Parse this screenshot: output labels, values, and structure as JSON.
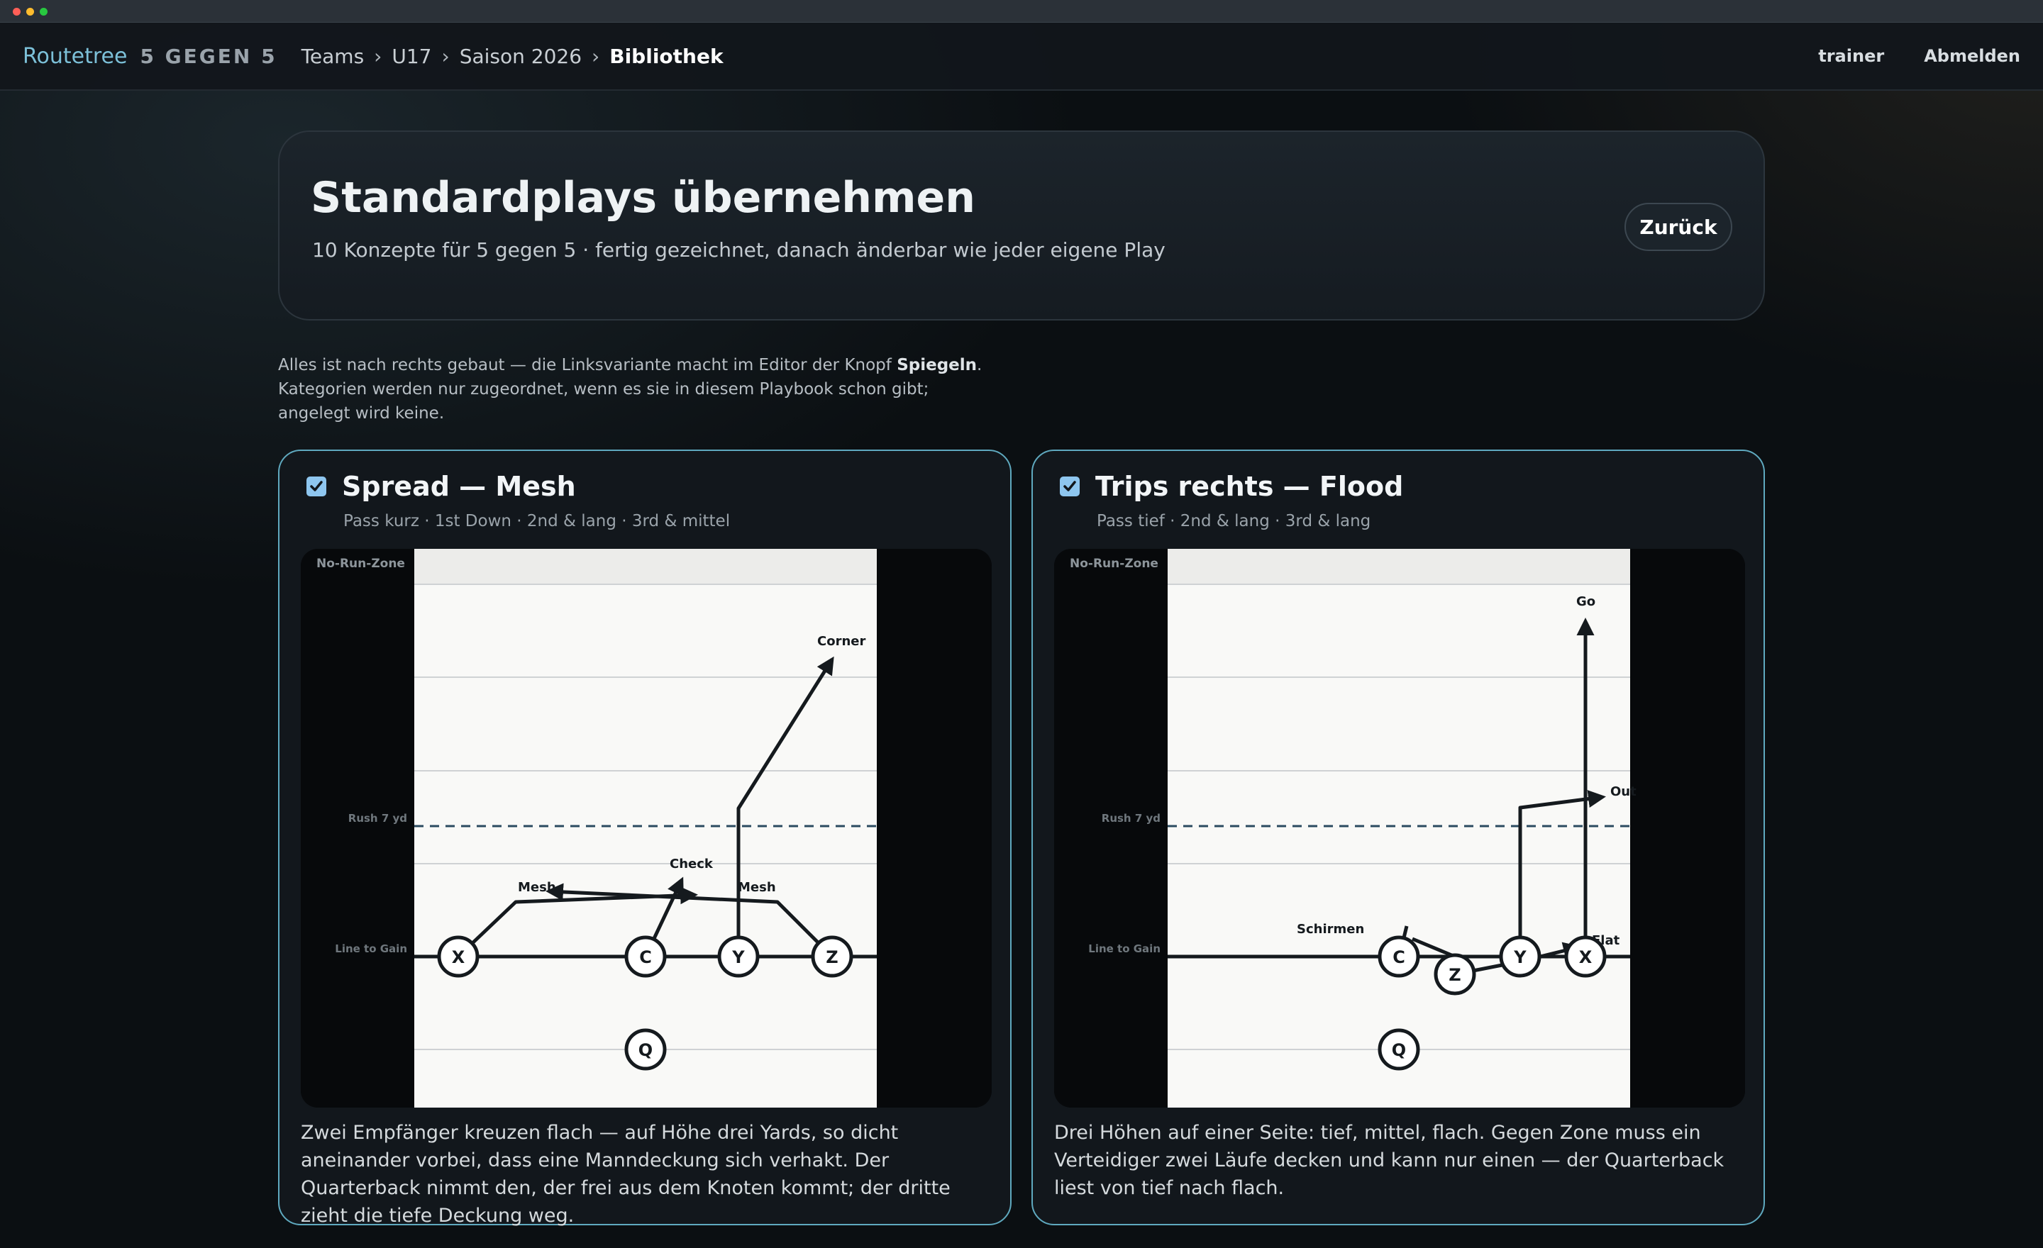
{
  "topbar": {
    "brand": "Routetree",
    "subtitle": "5 GEGEN 5",
    "breadcrumb": [
      "Teams",
      "U17",
      "Saison 2026",
      "Bibliothek"
    ],
    "user": "trainer",
    "logout": "Abmelden"
  },
  "hero": {
    "title": "Standardplays übernehmen",
    "subtitle": "10 Konzepte für 5 gegen 5 · fertig gezeichnet, danach änderbar wie jeder eigene Play",
    "back_label": "Zurück"
  },
  "note": {
    "line1_pre": "Alles ist nach rechts gebaut — die Linksvariante macht im Editor der Knopf ",
    "line1_bold": "Spiegeln",
    "line1_post": ".",
    "line2": "Kategorien werden nur zugeordnet, wenn es sie in diesem Playbook schon gibt;",
    "line3": "angelegt wird keine."
  },
  "field_labels": {
    "no_run": "No-Run-Zone",
    "rush": "Rush 7 yd",
    "ltg": "Line to Gain"
  },
  "plays": [
    {
      "checked": true,
      "title": "Spread — Mesh",
      "tags": "Pass kurz · 1st Down · 2nd & lang · 3rd & mittel",
      "description": "Zwei Empfänger kreuzen flach — auf Höhe drei Yards, so dicht aneinander vorbei, dass eine Manndeckung sich verhakt. Der Quarterback nimmt den, der frei aus dem Knoten kommt; der dritte zieht die tiefe Deckung weg.",
      "players": [
        "X",
        "C",
        "Y",
        "Z",
        "Q"
      ],
      "routes": [
        "Corner",
        "Check",
        "Mesh",
        "Mesh"
      ]
    },
    {
      "checked": true,
      "title": "Trips rechts — Flood",
      "tags": "Pass tief · 2nd & lang · 3rd & lang",
      "description": "Drei Höhen auf einer Seite: tief, mittel, flach. Gegen Zone muss ein Verteidiger zwei Läufe decken und kann nur einen — der Quarterback liest von tief nach flach.",
      "players": [
        "C",
        "Z",
        "Y",
        "X",
        "Q"
      ],
      "routes": [
        "Go",
        "Out",
        "Flat",
        "Schirmen"
      ]
    }
  ],
  "colors": {
    "accent": "#7cc0d8",
    "card_border": "#5fa9bf",
    "checkbox": "#8ec6ef",
    "field": "#f9f9f7",
    "rush_line": "#2b4a60"
  }
}
